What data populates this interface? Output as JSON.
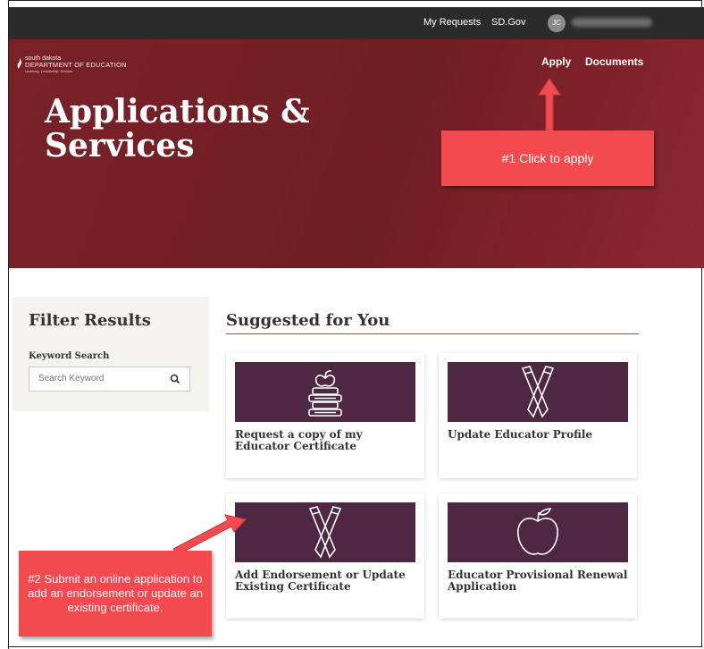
{
  "topbar": {
    "my_requests": "My Requests",
    "sd_gov": "SD.Gov",
    "avatar_initials": "JC"
  },
  "header": {
    "logo_line1": "south dakota",
    "logo_line2": "DEPARTMENT OF EDUCATION",
    "logo_tagline": "Learning. Leadership. Service.",
    "nav": {
      "apply": "Apply",
      "documents": "Documents"
    },
    "title_line1": "Applications &",
    "title_line2": "Services"
  },
  "annotations": {
    "callout1": "#1 Click to apply",
    "callout2": "#2 Submit an online application to add an endorsement or update an existing certificate."
  },
  "filter": {
    "title": "Filter Results",
    "keyword_label": "Keyword Search",
    "placeholder": "Search Keyword"
  },
  "suggested": {
    "title": "Suggested for You",
    "cards": [
      {
        "title": "Request a copy of my Educator Certificate",
        "icon": "books-apple-icon"
      },
      {
        "title": "Update Educator Profile",
        "icon": "pencils-icon"
      },
      {
        "title": "Add Endorsement or Update Existing Certificate",
        "icon": "pencils-icon"
      },
      {
        "title": "Educator Provisional Renewal Application",
        "icon": "apple-icon"
      }
    ]
  },
  "colors": {
    "topbar": "#2b2b2b",
    "hero": "#6f1e24",
    "card_image": "#4e2842",
    "callout": "#f24a4f",
    "accent_line": "#c63b43"
  }
}
